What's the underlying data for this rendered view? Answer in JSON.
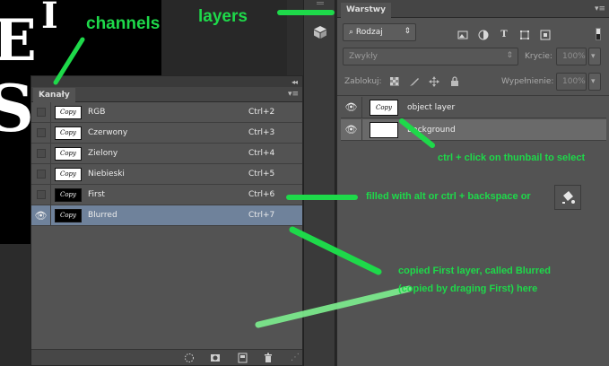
{
  "canvas": {
    "glyphs": [
      "E",
      "I",
      "S"
    ]
  },
  "channels_panel": {
    "collapse_label": "◂◂",
    "close_label": "✕",
    "tab_label": "Kanały",
    "menu_label": "▾≡",
    "rows": [
      {
        "name": "RGB",
        "shortcut": "Ctrl+2",
        "visible": false,
        "thumb": "light",
        "thumb_text": "Copy"
      },
      {
        "name": "Czerwony",
        "shortcut": "Ctrl+3",
        "visible": false,
        "thumb": "light",
        "thumb_text": "Copy"
      },
      {
        "name": "Zielony",
        "shortcut": "Ctrl+4",
        "visible": false,
        "thumb": "light",
        "thumb_text": "Copy"
      },
      {
        "name": "Niebieski",
        "shortcut": "Ctrl+5",
        "visible": false,
        "thumb": "light",
        "thumb_text": "Copy"
      },
      {
        "name": "First",
        "shortcut": "Ctrl+6",
        "visible": false,
        "thumb": "dark",
        "thumb_text": "Copy"
      },
      {
        "name": "Blurred",
        "shortcut": "Ctrl+7",
        "visible": true,
        "thumb": "dark",
        "thumb_text": "Copy",
        "selected": true
      }
    ],
    "bottom_icons": [
      "dotted-circle-icon",
      "mask-icon",
      "new-channel-icon",
      "trash-icon"
    ]
  },
  "layers_panel": {
    "tab_label": "Warstwy",
    "menu_label": "▾≡",
    "filter_kind": "Rodzaj",
    "blend_mode": "Zwykły",
    "opacity_label": "Krycie:",
    "opacity_value": "100%",
    "lock_label": "Zablokuj:",
    "fill_label": "Wypełnienie:",
    "fill_value": "100%",
    "layers": [
      {
        "name": "object layer",
        "thumb_text": "Copy"
      },
      {
        "name": "Background"
      }
    ]
  },
  "annotations": {
    "channels": "channels",
    "layers": "layers",
    "ctrl_click": "ctrl  + click on thunbail to select",
    "filled_with": "filled with alt or ctrl + backspace or",
    "copied_1": "copied First layer, called Blurred",
    "copied_2": "(copied by draging First) here"
  },
  "colors": {
    "annotation": "#1ed94a",
    "selected_row": "#6f829b",
    "panel_bg": "#535353"
  }
}
